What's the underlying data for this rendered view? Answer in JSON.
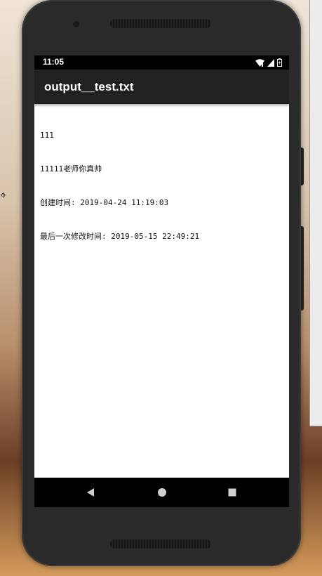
{
  "status_bar": {
    "time": "11:05"
  },
  "app_bar": {
    "title": "output__test.txt"
  },
  "file_content": {
    "lines": [
      "111",
      "11111老师你真帅",
      "创建时间: 2019-04-24 11:19:03",
      "最后一次修改时间: 2019-05-15 22:49:21"
    ]
  },
  "navigation": {
    "icons": [
      "back-icon",
      "home-icon",
      "recents-icon"
    ]
  },
  "background": {
    "glyph": "⌖"
  }
}
